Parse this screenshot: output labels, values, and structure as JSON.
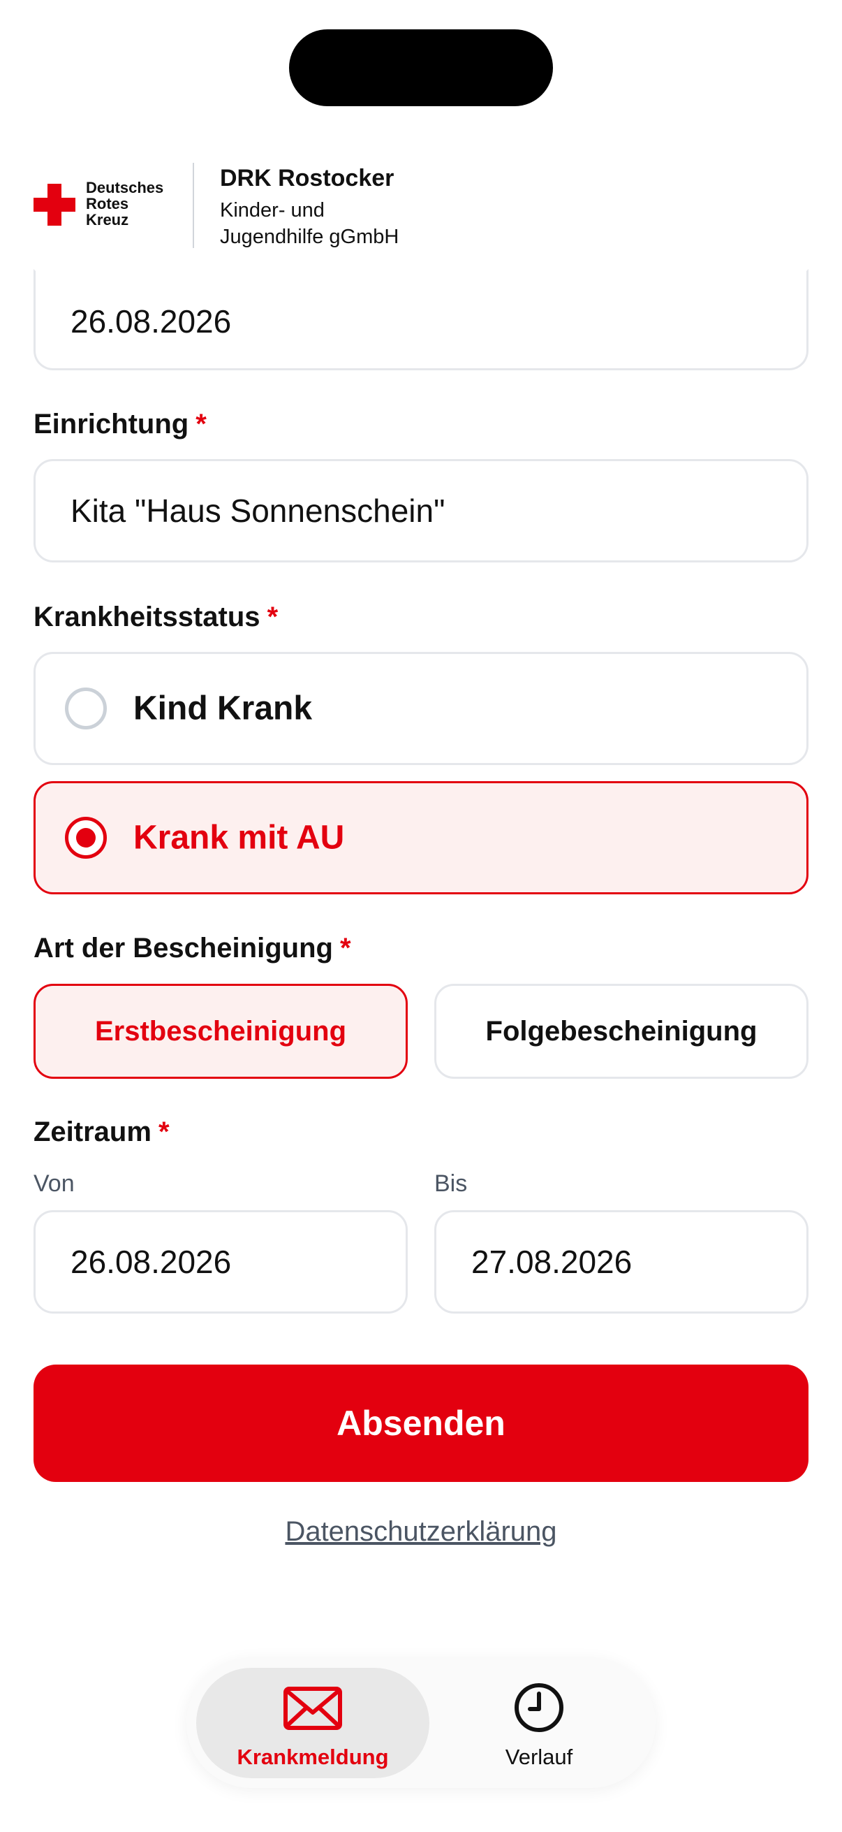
{
  "header": {
    "logo_line1": "Deutsches",
    "logo_line2": "Rotes",
    "logo_line3": "Kreuz",
    "org_name": "DRK Rostocker",
    "org_sub_line1": "Kinder- und",
    "org_sub_line2": "Jugendhilfe gGmbH"
  },
  "form": {
    "date_top_value": "26.08.2026",
    "einrichtung": {
      "label": "Einrichtung",
      "required": "*",
      "value": "Kita \"Haus Sonnenschein\""
    },
    "krankheitsstatus": {
      "label": "Krankheitsstatus",
      "required": "*",
      "options": [
        {
          "label": "Kind Krank",
          "selected": false
        },
        {
          "label": "Krank mit AU",
          "selected": true
        }
      ]
    },
    "bescheinigung": {
      "label": "Art der Bescheinigung",
      "required": "*",
      "options": [
        {
          "label": "Erstbescheinigung",
          "selected": true
        },
        {
          "label": "Folgebescheinigung",
          "selected": false
        }
      ]
    },
    "zeitraum": {
      "label": "Zeitraum",
      "required": "*",
      "von_label": "Von",
      "von_value": "26.08.2026",
      "bis_label": "Bis",
      "bis_value": "27.08.2026"
    },
    "submit_label": "Absenden",
    "privacy_link": "Datenschutzerklärung"
  },
  "tabbar": {
    "tabs": [
      {
        "label": "Krankmeldung",
        "icon": "envelope-icon",
        "active": true
      },
      {
        "label": "Verlauf",
        "icon": "clock-icon",
        "active": false
      }
    ]
  },
  "colors": {
    "accent": "#e3000f",
    "selected_bg": "#fdf0ef",
    "border": "#e5e7eb"
  }
}
